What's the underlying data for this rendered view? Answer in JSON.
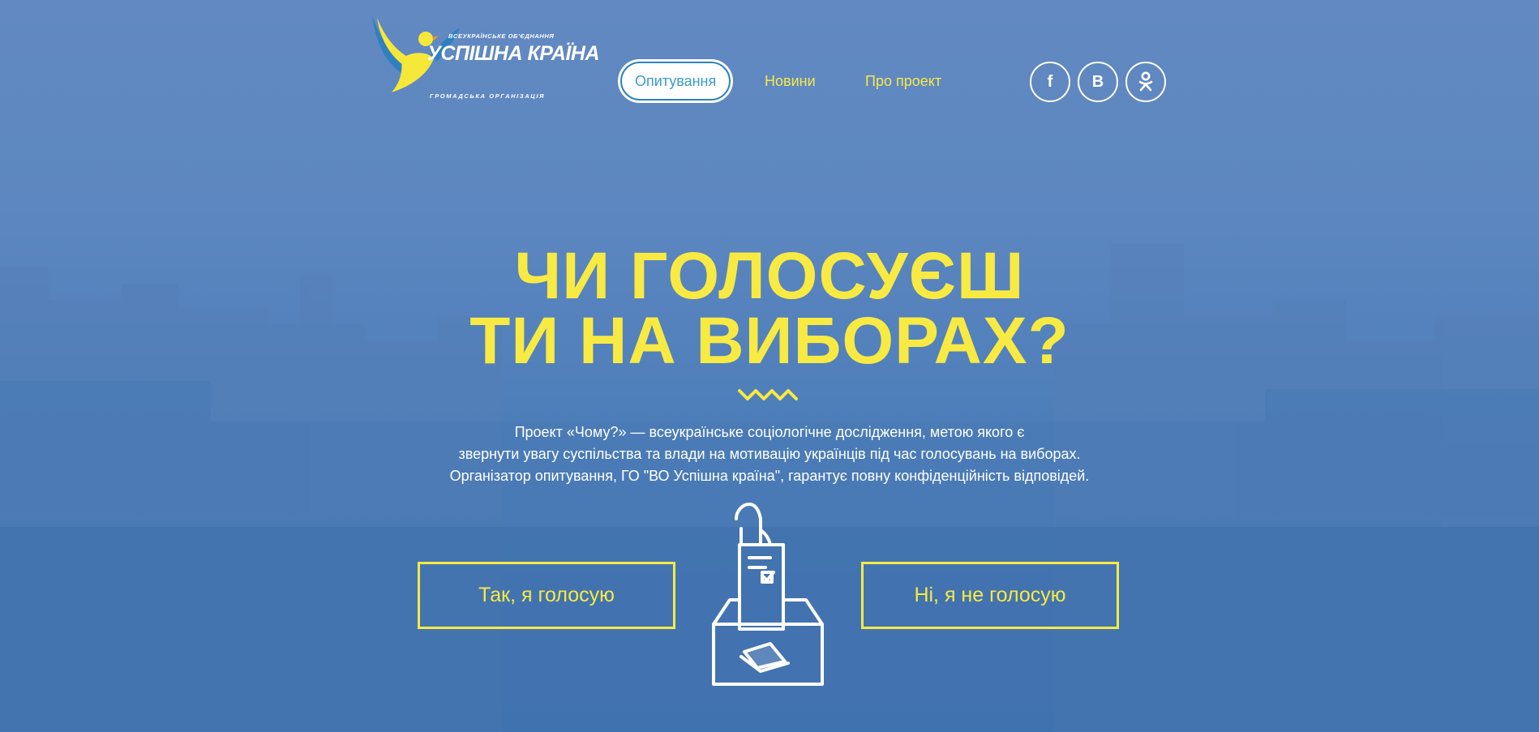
{
  "logo": {
    "top_text": "всеукраїнське об'єднання",
    "main_text": "УСПІШНА КРАЇНА",
    "sub_text": "громадська організація"
  },
  "nav": {
    "items": [
      {
        "label": "Опитування",
        "active": true
      },
      {
        "label": "Новини",
        "active": false
      },
      {
        "label": "Про проект",
        "active": false
      }
    ]
  },
  "social": [
    {
      "label": "f",
      "icon": "facebook-icon"
    },
    {
      "label": "B",
      "icon": "vk-icon"
    },
    {
      "label": "ok",
      "icon": "odnoklassniki-icon"
    }
  ],
  "hero": {
    "title_line1": "ЧИ ГОЛОСУЄШ",
    "title_line2": "ТИ НА ВИБОРАХ?",
    "description": [
      "Проект «Чому?» — всеукраїнське соціологічне дослідження, метою якого є",
      "звернути увагу суспільства та влади на мотивацію українців під час голосувань на виборах.",
      "Організатор опитування, ГО \"ВО Успішна країна\", гарантує повну конфіденційність відповідей."
    ]
  },
  "buttons": {
    "yes_label": "Так, я голосую",
    "no_label": "Ні, я не голосую"
  },
  "colors": {
    "accent_yellow": "#f8ea43",
    "background_blue": "#5b84bd",
    "active_nav_text": "#3b9bc9"
  }
}
